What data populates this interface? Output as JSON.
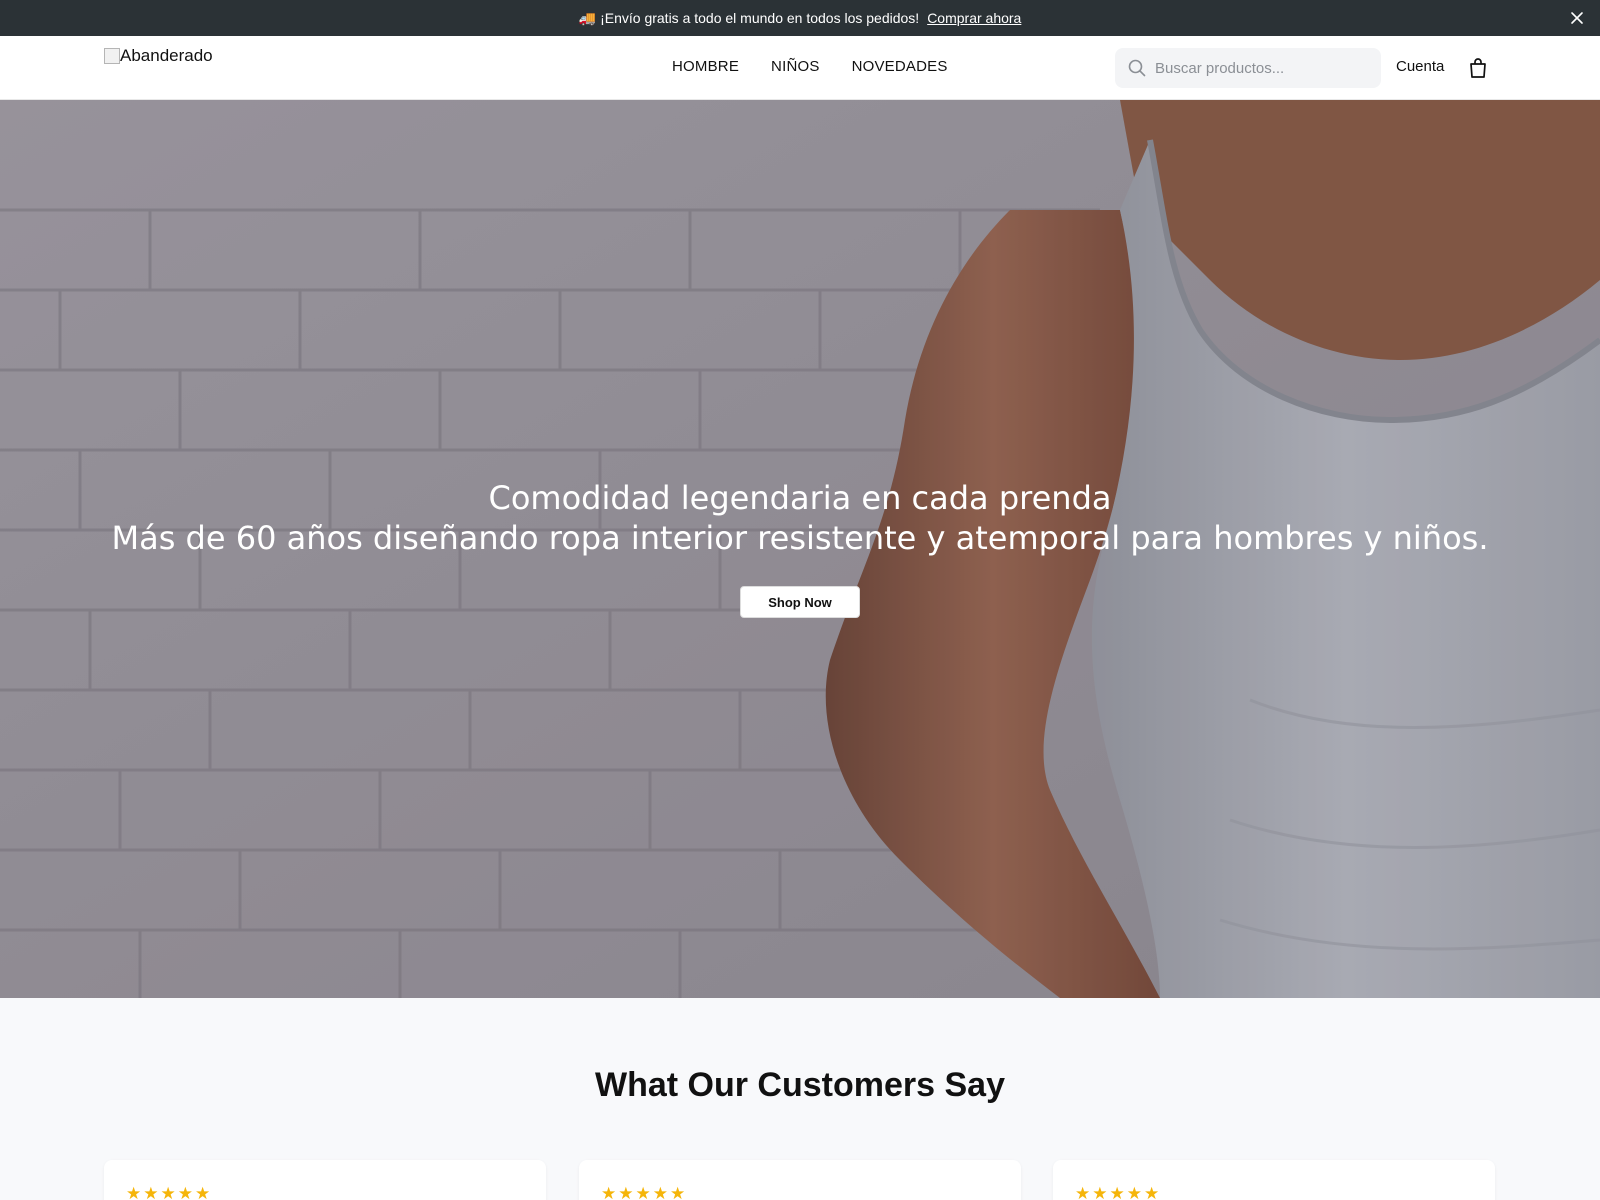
{
  "announcement": {
    "icon": "truck-icon",
    "text": "¡Envío gratis a todo el mundo en todos los pedidos!",
    "link": "Comprar ahora",
    "background": "#2b3236"
  },
  "header": {
    "logo_alt": "Abanderado",
    "nav": [
      "HOMBRE",
      "NIÑOS",
      "NOVEDADES"
    ],
    "search_placeholder": "Buscar productos...",
    "account_label": "Cuenta",
    "cart_icon": "shopping-bag-icon"
  },
  "hero": {
    "title": "Comodidad legendaria en cada prenda",
    "subtitle": "Más de 60 años diseñando ropa interior resistente y atemporal para hombres y niños.",
    "cta": "Shop Now"
  },
  "testimonials": {
    "heading": "What Our Customers Say",
    "cards": [
      {
        "stars": "★★★★★"
      },
      {
        "stars": "★★★★★"
      },
      {
        "stars": "★★★★★"
      }
    ],
    "star_color": "#f5b50a"
  }
}
